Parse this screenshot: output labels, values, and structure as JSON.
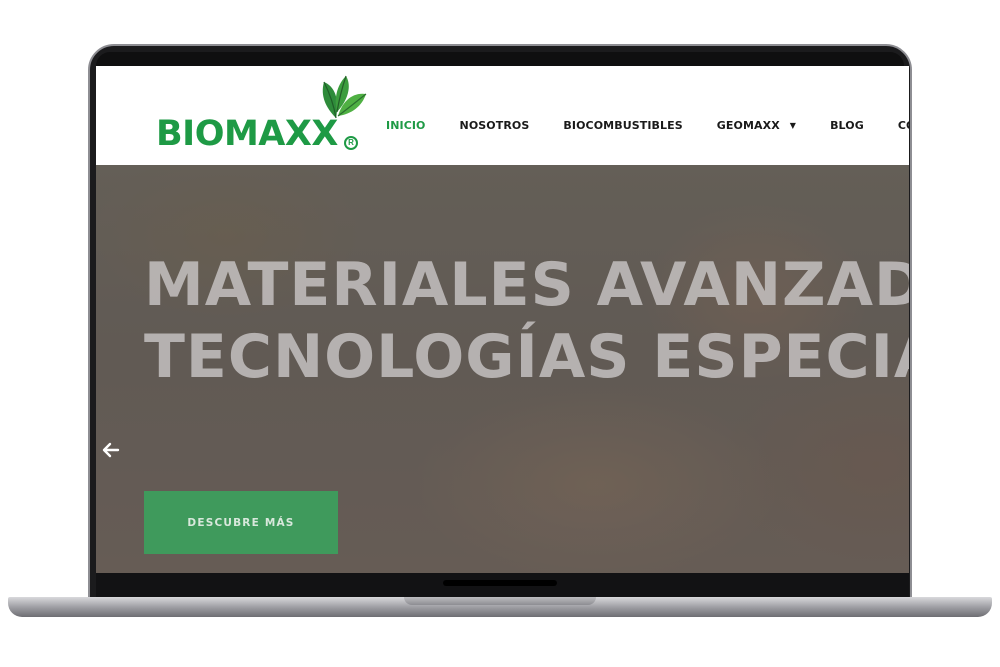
{
  "brand": {
    "name": "BIOMAXX",
    "registered_mark": "R",
    "primary_color": "#1e9a45",
    "icon": "leaf-icon"
  },
  "nav": {
    "items": [
      {
        "label": "INICIO",
        "active": true
      },
      {
        "label": "NOSOTROS",
        "active": false
      },
      {
        "label": "BIOCOMBUSTIBLES",
        "active": false
      },
      {
        "label": "GEOMAXX",
        "active": false,
        "has_dropdown": true
      },
      {
        "label": "BLOG",
        "active": false
      },
      {
        "label": "CO",
        "active": false
      }
    ],
    "dropdown_icon": "caret-down-icon"
  },
  "hero": {
    "title_line1": "MATERIALES AVANZADO",
    "title_line2": "TECNOLOGÍAS ESPECIAL",
    "prev_icon": "arrow-left-icon",
    "cta_label": "DESCUBRE MÁS",
    "cta_color": "#3f9a5c"
  }
}
